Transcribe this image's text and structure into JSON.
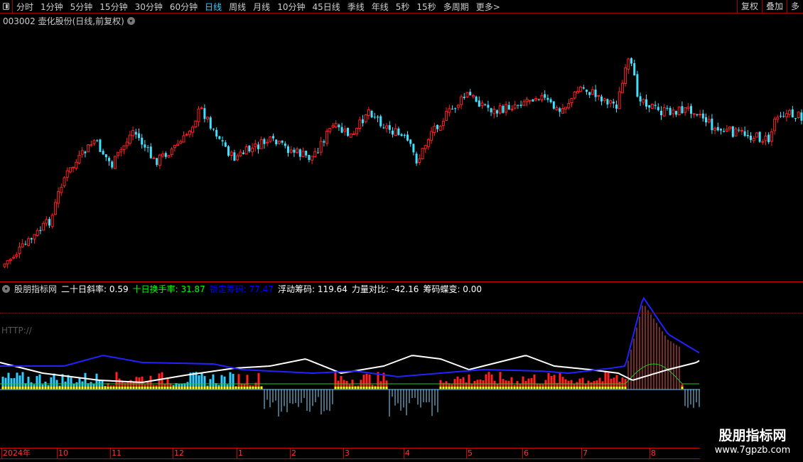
{
  "toolbar": {
    "periods": [
      "分时",
      "1分钟",
      "5分钟",
      "15分钟",
      "30分钟",
      "60分钟",
      "日线",
      "周线",
      "月线",
      "10分钟",
      "45日线",
      "季线",
      "年线",
      "5秒",
      "15秒",
      "多周期",
      "更多>"
    ],
    "active": "日线",
    "right": [
      "复权",
      "叠加",
      "多"
    ]
  },
  "chart_title": "003002 壶化股份(日线,前复权)",
  "indicator": {
    "name": "股朋指标网",
    "items": [
      {
        "label": "二十日斜率: 0.59",
        "color": "#ffffff"
      },
      {
        "label": "十日换手率: 31.87",
        "color": "#00ff00"
      },
      {
        "label": "锁定筹码: 77.47",
        "color": "#0000ff"
      },
      {
        "label": "浮动筹码: 119.64",
        "color": "#ffffff"
      },
      {
        "label": "力量对比: -42.16",
        "color": "#ffffff"
      },
      {
        "label": "筹码蝶变: 0.00",
        "color": "#ffffff"
      }
    ],
    "http_label": "HTTP://"
  },
  "time_axis": [
    "2024年",
    "10",
    "11",
    "12",
    "1",
    "2",
    "3",
    "4",
    "5",
    "6",
    "7",
    "8"
  ],
  "watermark": {
    "name": "股朋指标网",
    "url": "www.7gpzb.com"
  },
  "colors": {
    "up": "#ff2020",
    "down": "#40e0ff",
    "accent": "#c00000"
  }
}
